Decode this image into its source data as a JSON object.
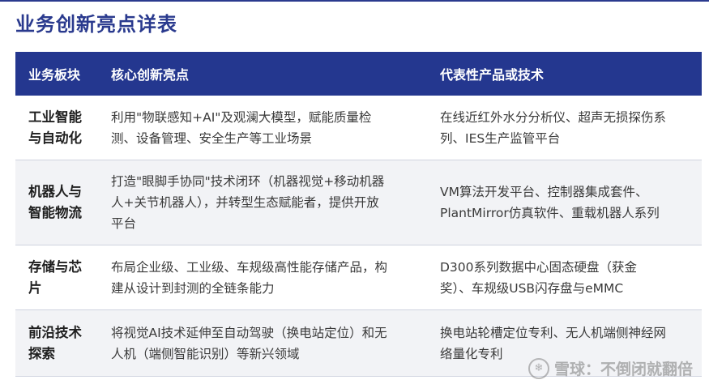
{
  "title": "业务创新亮点详表",
  "table": {
    "headers": [
      "业务板块",
      "核心创新亮点",
      "代表性产品或技术"
    ],
    "rows": [
      {
        "sector": [
          "工业智能",
          "与自动化"
        ],
        "innovation": [
          "利用\"物联感知+AI\"及观澜大模型，赋能质量检",
          "测、设备管理、安全生产等工业场景"
        ],
        "products": [
          "在线近红外水分分析仪、超声无损探伤系",
          "列、IES生产监管平台"
        ]
      },
      {
        "sector": [
          "机器人与",
          "智能物流"
        ],
        "innovation": [
          "打造\"眼脚手协同\"技术闭环（机器视觉+移动机器",
          "人+关节机器人），并转型生态赋能者，提供开放",
          "平台"
        ],
        "products": [
          "VM算法开发平台、控制器集成套件、",
          "PlantMirror仿真软件、重载机器人系列"
        ]
      },
      {
        "sector": [
          "存储与芯",
          "片"
        ],
        "innovation": [
          "布局企业级、工业级、车规级高性能存储产品，构",
          "建从设计到封测的全链条能力"
        ],
        "products": [
          "D300系列数据中心固态硬盘（获金",
          "奖）、车规级USB闪存盘与eMMC"
        ]
      },
      {
        "sector": [
          "前沿技术",
          "探索"
        ],
        "innovation": [
          "将视觉AI技术延伸至自动驾驶（换电站定位）和无",
          "人机（端侧智能识别）等新兴领域"
        ],
        "products": [
          "换电站轮槽定位专利、无人机端侧神经网",
          "络量化专利"
        ]
      }
    ]
  },
  "watermark": {
    "icon": "snowball-icon",
    "text": "雪球：不倒闭就翻倍"
  },
  "colors": {
    "header_bg": "#24378f",
    "title": "#2a3a8e",
    "alt_row": "#f2f3f6"
  }
}
